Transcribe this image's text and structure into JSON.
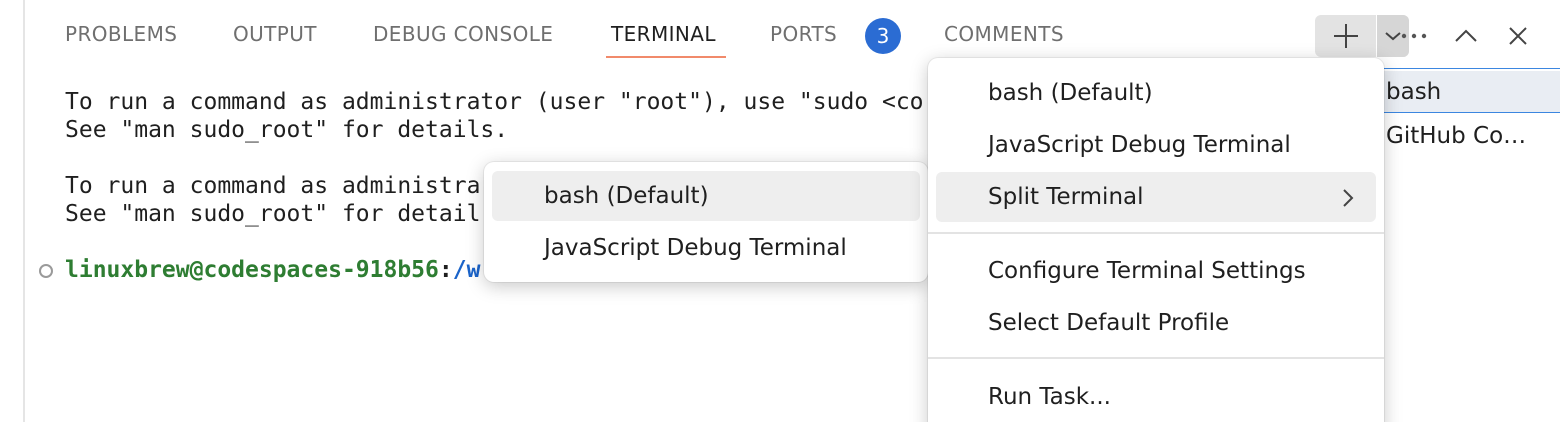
{
  "tabs": [
    {
      "label": "PROBLEMS"
    },
    {
      "label": "OUTPUT"
    },
    {
      "label": "DEBUG CONSOLE"
    },
    {
      "label": "TERMINAL"
    },
    {
      "label": "PORTS"
    },
    {
      "label": "COMMENTS"
    }
  ],
  "ports_badge": "3",
  "terminal": {
    "lines": [
      "To run a command as administrator (user \"root\"), use \"sudo <co",
      "See \"man sudo_root\" for details.",
      "",
      "To run a command as administra",
      "See \"man sudo_root\" for detail"
    ],
    "prompt_user": "linuxbrew@codespaces-918b56",
    "prompt_sep": ":",
    "prompt_path": "/w"
  },
  "side_list": [
    {
      "label": "bash"
    },
    {
      "label": "GitHub Co…"
    }
  ],
  "main_menu": {
    "items": [
      {
        "label": "bash (Default)"
      },
      {
        "label": "JavaScript Debug Terminal"
      },
      {
        "label": "Split Terminal"
      },
      {
        "label": "Configure Terminal Settings"
      },
      {
        "label": "Select Default Profile"
      },
      {
        "label": "Run Task..."
      }
    ]
  },
  "sub_menu": {
    "items": [
      {
        "label": "bash (Default)"
      },
      {
        "label": "JavaScript Debug Terminal"
      }
    ]
  },
  "icons": {
    "new_terminal": "plus-icon",
    "dropdown": "chevron-down-icon",
    "more": "ellipsis-icon",
    "maximize": "chevron-up-icon",
    "close": "close-icon",
    "submenu": "chevron-right-icon"
  },
  "colors": {
    "accent_underline": "#f18a6b",
    "badge": "#2b6cd3",
    "prompt_user": "#2e7d32",
    "prompt_path": "#1a63c9"
  }
}
